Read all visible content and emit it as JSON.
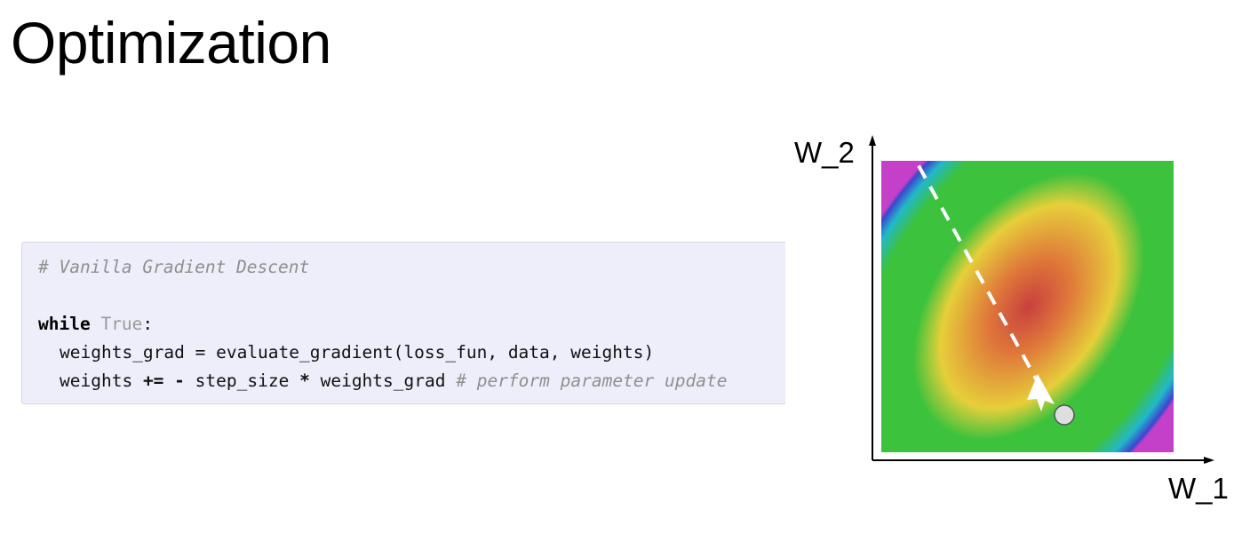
{
  "title": "Optimization",
  "code": {
    "comment_line": "# Vanilla Gradient Descent",
    "loop_keyword": "while",
    "loop_condition": "True",
    "loop_colon": ":",
    "line_grad": "weights_grad = evaluate_gradient(loss_fun, data, weights)",
    "update_lhs": "weights",
    "update_op": "+=",
    "update_minus": "-",
    "update_mid": "step_size",
    "update_star": "*",
    "update_rhs": "weights_grad",
    "update_comment": "# perform parameter update"
  },
  "diagram": {
    "x_axis_label": "W_1",
    "y_axis_label": "W_2",
    "colors": {
      "center": "#c8403e",
      "inner": "#e07a3a",
      "mid": "#e6cf3a",
      "outer": "#3cc23c",
      "edge_cyan": "#22b8c8",
      "edge_blue": "#3b46d0",
      "edge_magenta": "#c440c8",
      "path": "#ffffff",
      "marker": "#dedede"
    }
  }
}
